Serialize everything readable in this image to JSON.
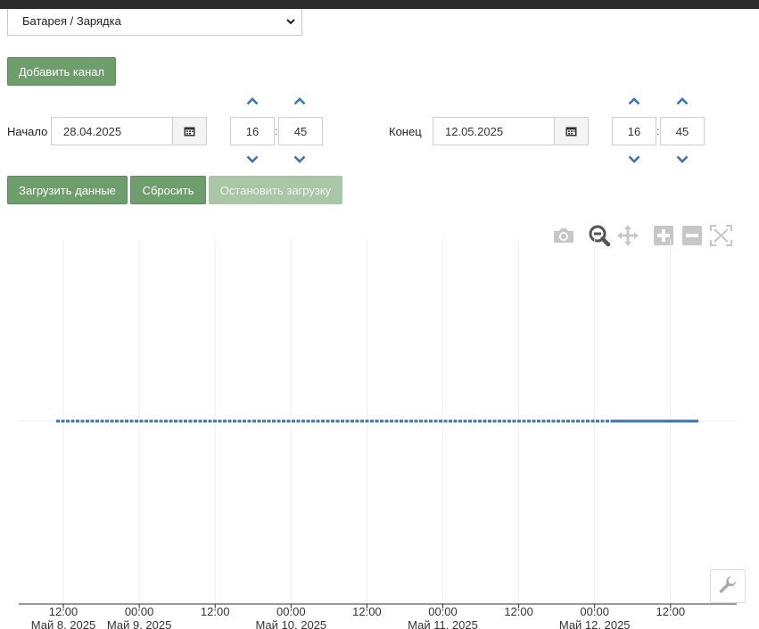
{
  "channel_select": {
    "value": "Батарея / Зарядка"
  },
  "buttons": {
    "add_channel": "Добавить канал",
    "load_data": "Загрузить данные",
    "reset": "Сбросить",
    "stop_loading": "Остановить загрузку"
  },
  "start": {
    "label": "Начало",
    "date": "28.04.2025",
    "hour": "16",
    "minute": "45"
  },
  "end": {
    "label": "Конец",
    "date": "12.05.2025",
    "hour": "16",
    "minute": "45"
  },
  "time_separator": ":",
  "colors": {
    "button_green": "#6f9e6d",
    "series": "#3a74ae",
    "spinner_arrow": "#3b73ad"
  },
  "chart_data": {
    "type": "line",
    "x_axis": {
      "ticks": [
        {
          "time": "12:00",
          "date": "Май 8, 2025"
        },
        {
          "time": "00:00",
          "date": "Май 9, 2025"
        },
        {
          "time": "12:00",
          "date": ""
        },
        {
          "time": "00:00",
          "date": "Май 10, 2025"
        },
        {
          "time": "12:00",
          "date": ""
        },
        {
          "time": "00:00",
          "date": "Май 11, 2025"
        },
        {
          "time": "12:00",
          "date": ""
        },
        {
          "time": "00:00",
          "date": "Май 12, 2025"
        },
        {
          "time": "12:00",
          "date": ""
        }
      ]
    },
    "series": [
      {
        "x_start": "2025-05-08 11:00",
        "x_end": "2025-05-12 18:00",
        "y": 0,
        "style": "dotted-dense"
      }
    ],
    "grid": true
  }
}
